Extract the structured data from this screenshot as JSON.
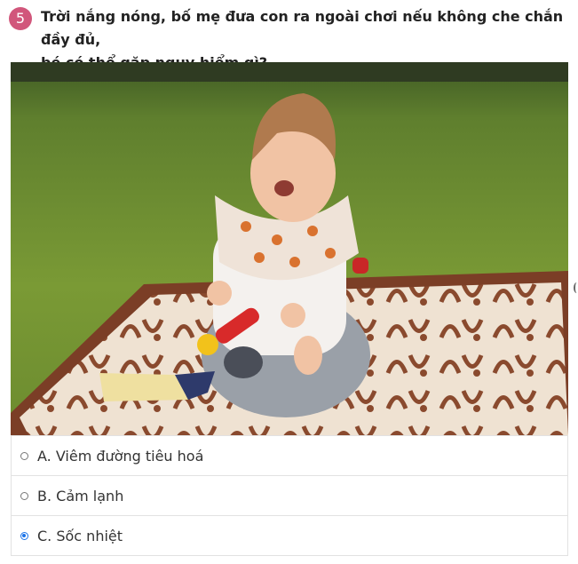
{
  "question": {
    "number": "5",
    "text_line1": "Trời nắng nóng, bố mẹ đưa con ra ngoài chơi nếu không che chắn đầy đủ,",
    "text_line2": "bé có thể gặp nguy hiểm gì?"
  },
  "image": {
    "description_icon": "photo-baby-crying-on-blanket"
  },
  "options": [
    {
      "label": "A. Viêm đường tiêu hoá",
      "selected": false
    },
    {
      "label": "B. Cảm lạnh",
      "selected": false
    },
    {
      "label": "C. Sốc nhiệt",
      "selected": true
    }
  ],
  "colors": {
    "badge": "#d1567b",
    "radio_selected": "#1a73e8"
  }
}
